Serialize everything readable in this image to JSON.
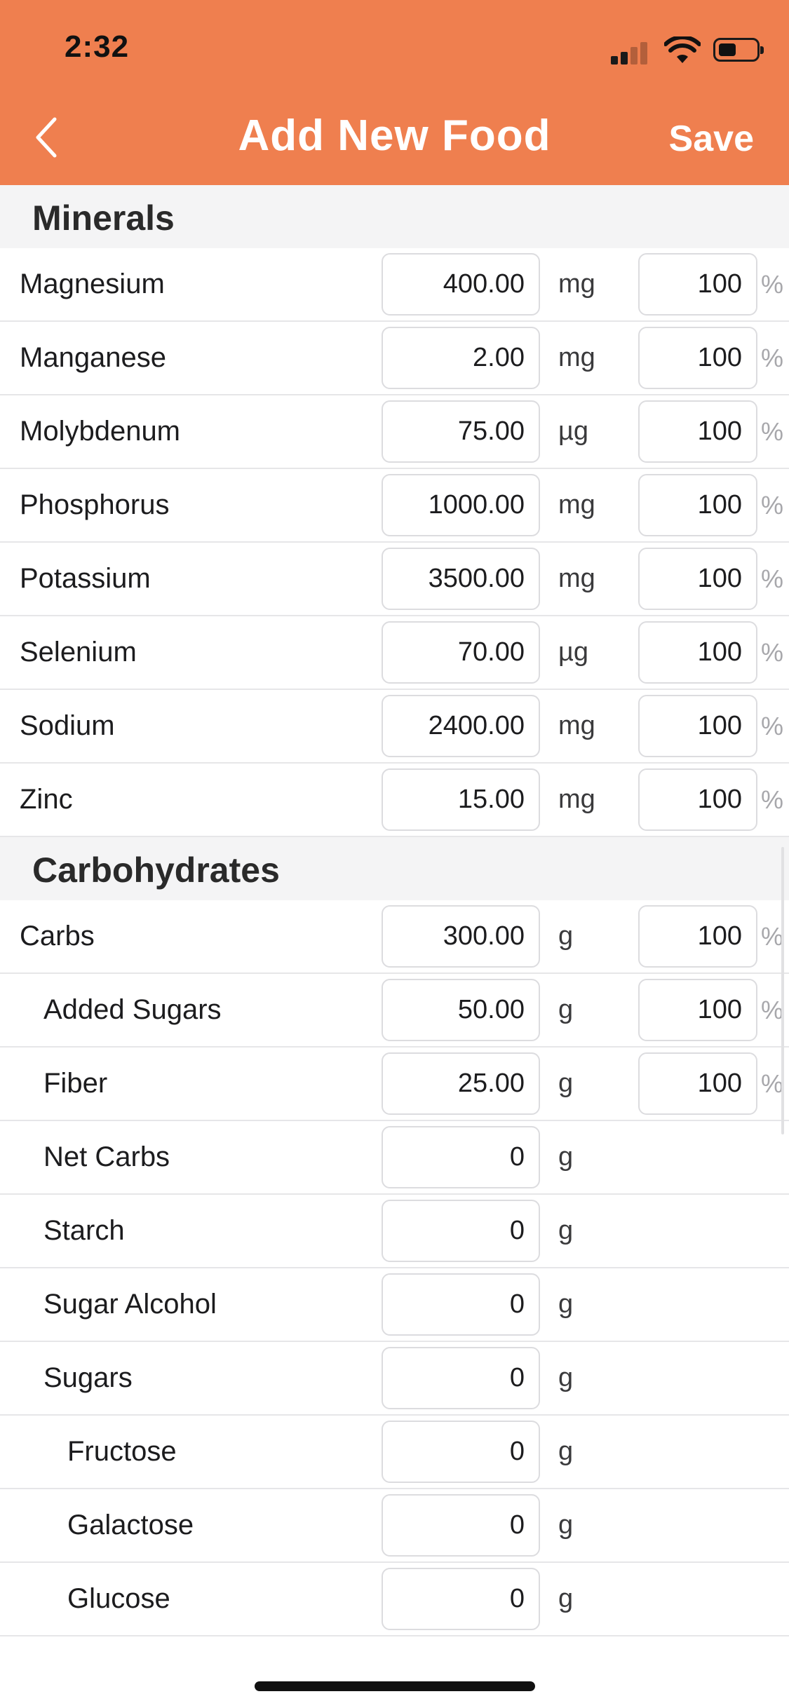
{
  "status_bar": {
    "time": "2:32"
  },
  "nav": {
    "title": "Add New Food",
    "save_label": "Save"
  },
  "colors": {
    "header": "#ef7f4f",
    "section_bg": "#f4f4f5"
  },
  "sections": [
    {
      "title": "Minerals",
      "rows": [
        {
          "label": "Magnesium",
          "amount": "400.00",
          "unit": "mg",
          "percent": "100",
          "percent_sign": "%"
        },
        {
          "label": "Manganese",
          "amount": "2.00",
          "unit": "mg",
          "percent": "100",
          "percent_sign": "%"
        },
        {
          "label": "Molybdenum",
          "amount": "75.00",
          "unit": "µg",
          "percent": "100",
          "percent_sign": "%"
        },
        {
          "label": "Phosphorus",
          "amount": "1000.00",
          "unit": "mg",
          "percent": "100",
          "percent_sign": "%"
        },
        {
          "label": "Potassium",
          "amount": "3500.00",
          "unit": "mg",
          "percent": "100",
          "percent_sign": "%"
        },
        {
          "label": "Selenium",
          "amount": "70.00",
          "unit": "µg",
          "percent": "100",
          "percent_sign": "%"
        },
        {
          "label": "Sodium",
          "amount": "2400.00",
          "unit": "mg",
          "percent": "100",
          "percent_sign": "%"
        },
        {
          "label": "Zinc",
          "amount": "15.00",
          "unit": "mg",
          "percent": "100",
          "percent_sign": "%"
        }
      ]
    },
    {
      "title": "Carbohydrates",
      "rows": [
        {
          "label": "Carbs",
          "amount": "300.00",
          "unit": "g",
          "percent": "100",
          "percent_sign": "%"
        },
        {
          "label": "Added Sugars",
          "amount": "50.00",
          "unit": "g",
          "percent": "100",
          "percent_sign": "%"
        },
        {
          "label": "Fiber",
          "amount": "25.00",
          "unit": "g",
          "percent": "100",
          "percent_sign": "%"
        },
        {
          "label": "Net Carbs",
          "amount": "0",
          "unit": "g"
        },
        {
          "label": "Starch",
          "amount": "0",
          "unit": "g"
        },
        {
          "label": "Sugar Alcohol",
          "amount": "0",
          "unit": "g"
        },
        {
          "label": "Sugars",
          "amount": "0",
          "unit": "g"
        },
        {
          "label": "Fructose",
          "amount": "0",
          "unit": "g"
        },
        {
          "label": "Galactose",
          "amount": "0",
          "unit": "g"
        },
        {
          "label": "Glucose",
          "amount": "0",
          "unit": "g"
        }
      ]
    }
  ]
}
